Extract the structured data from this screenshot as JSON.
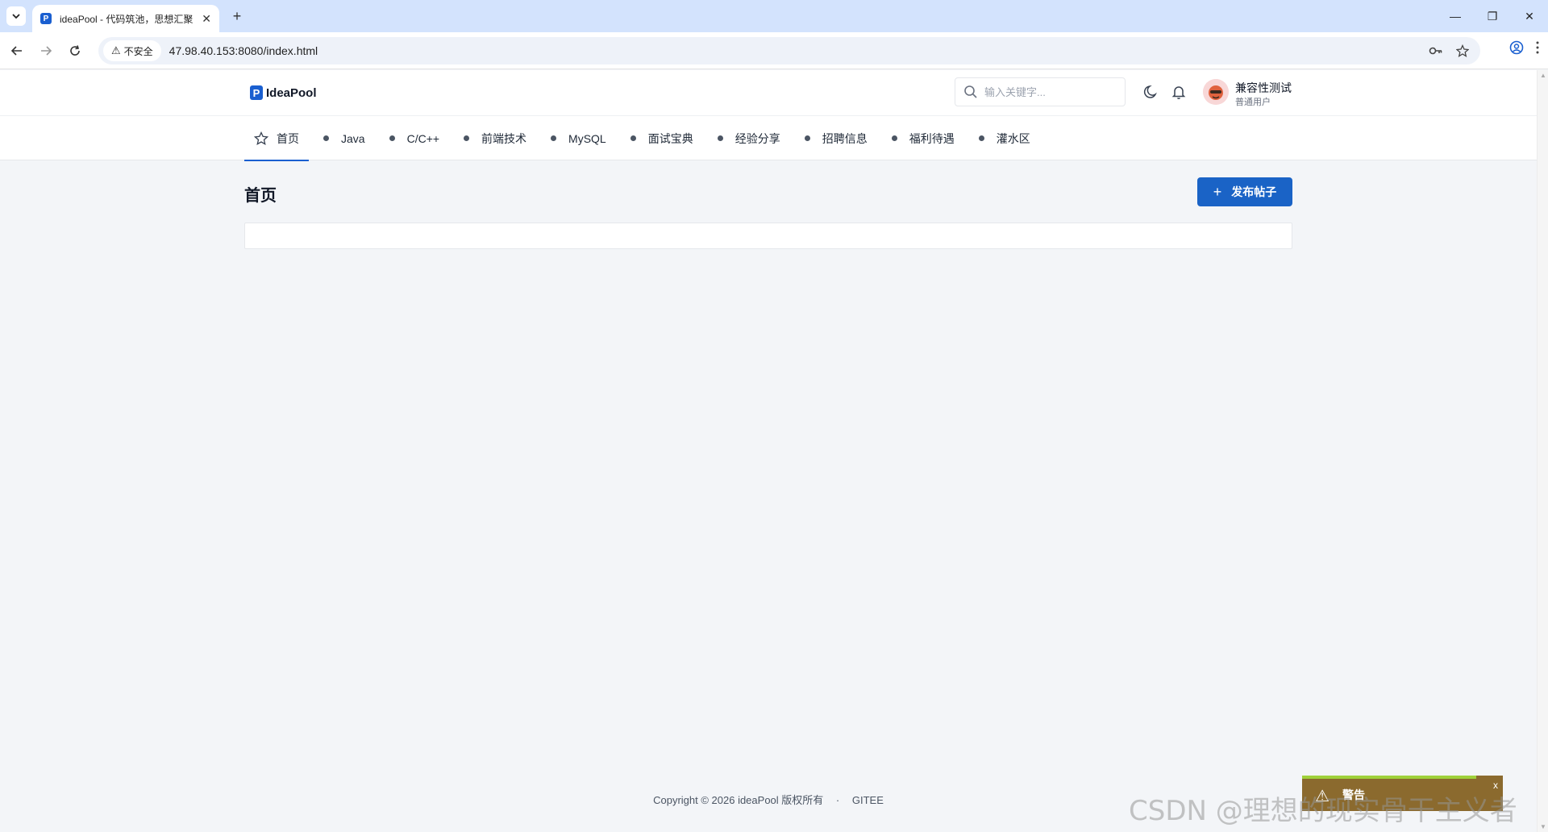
{
  "browser": {
    "tab_title": "ideaPool - 代码筑池，思想汇聚",
    "tab_favicon": "P",
    "tab_close": "✕",
    "new_tab": "+",
    "security_label": "不安全",
    "url": "47.98.40.153:8080/index.html",
    "window_controls": [
      "—",
      "❐",
      "✕"
    ]
  },
  "header": {
    "logo_mark": "P",
    "logo_text": "IdeaPool",
    "search_placeholder": "输入关键字...",
    "user_name": "兼容性测试",
    "user_role": "普通用户"
  },
  "nav": {
    "items": [
      {
        "label": "首页",
        "icon": "star-icon",
        "active": true
      },
      {
        "label": "Java"
      },
      {
        "label": "C/C++"
      },
      {
        "label": "前端技术"
      },
      {
        "label": "MySQL"
      },
      {
        "label": "面试宝典"
      },
      {
        "label": "经验分享"
      },
      {
        "label": "招聘信息"
      },
      {
        "label": "福利待遇"
      },
      {
        "label": "灌水区"
      }
    ]
  },
  "main": {
    "page_title": "首页",
    "post_button_label": "发布帖子"
  },
  "footer": {
    "copyright": "Copyright © 2026 ideaPool 版权所有",
    "separator": "·",
    "gitee": "GITEE"
  },
  "toast": {
    "title": "警告",
    "close": "x"
  },
  "watermark": "CSDN @理想的现实骨干主义者",
  "colors": {
    "accent": "#1a63c6",
    "page_bg": "#f3f5f8",
    "tab_strip": "#d3e3fd",
    "toast_bg": "#8b6a2e"
  }
}
